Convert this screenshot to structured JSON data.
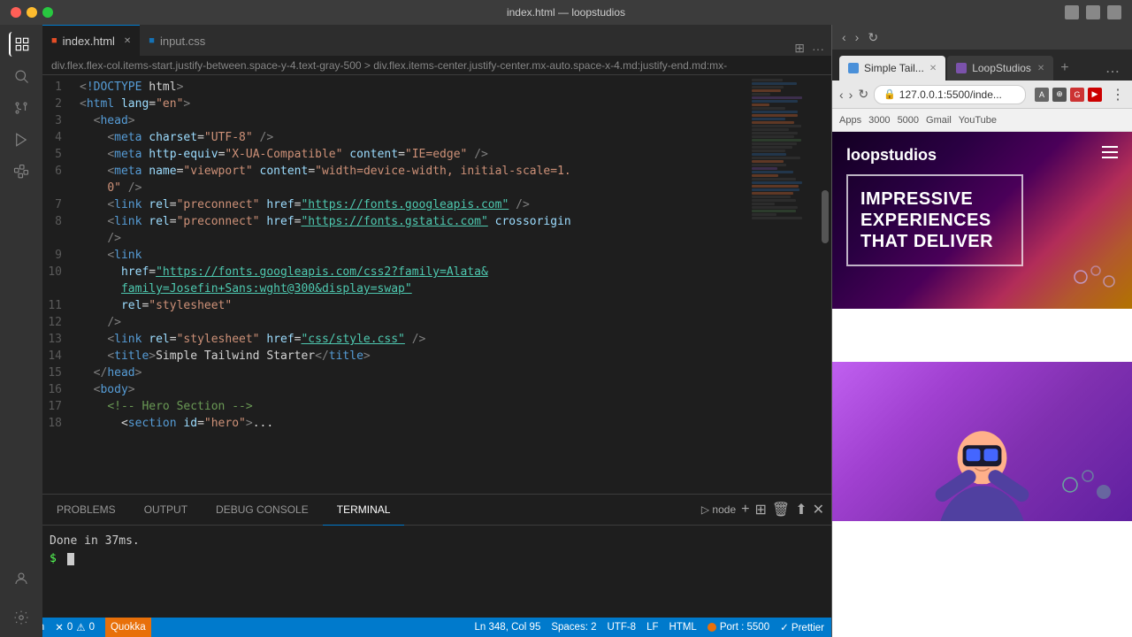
{
  "titlebar": {
    "title": "index.html — loopstudios"
  },
  "tabs": [
    {
      "name": "index.html",
      "type": "html",
      "active": true,
      "modified": false
    },
    {
      "name": "input.css",
      "type": "css",
      "active": false,
      "modified": false
    }
  ],
  "breadcrumb": "div.flex.flex-col.items-start.justify-between.space-y-4.text-gray-500 > div.flex.items-center.justify-center.mx-auto.space-x-4.md:justify-end.md:mx-",
  "code_lines": [
    {
      "num": "1",
      "html": "<span class='t-lt'>&lt;</span><span class='t-keyword'>!DOCTYPE</span><span class='t-plain'> html</span><span class='t-lt'>&gt;</span>"
    },
    {
      "num": "2",
      "html": "<span class='t-lt'>&lt;</span><span class='t-tag'>html</span> <span class='t-attr'>lang</span><span class='t-eq'>=</span><span class='t-val'>\"en\"</span><span class='t-lt'>&gt;</span>"
    },
    {
      "num": "3",
      "html": "  <span class='t-lt'>&lt;</span><span class='t-tag'>head</span><span class='t-lt'>&gt;</span>"
    },
    {
      "num": "4",
      "html": "    <span class='t-lt'>&lt;</span><span class='t-tag'>meta</span> <span class='t-attr'>charset</span><span class='t-eq'>=</span><span class='t-val'>\"UTF-8\"</span> <span class='t-lt'>/&gt;</span>"
    },
    {
      "num": "5",
      "html": "    <span class='t-lt'>&lt;</span><span class='t-tag'>meta</span> <span class='t-attr'>http-equiv</span><span class='t-eq'>=</span><span class='t-val'>\"X-UA-Compatible\"</span> <span class='t-attr'>content</span><span class='t-eq'>=</span><span class='t-val'>\"IE=edge\"</span> <span class='t-lt'>/&gt;</span>"
    },
    {
      "num": "6",
      "html": "    <span class='t-lt'>&lt;</span><span class='t-tag'>meta</span> <span class='t-attr'>name</span><span class='t-eq'>=</span><span class='t-val'>\"viewport\"</span> <span class='t-attr'>content</span><span class='t-eq'>=</span><span class='t-val'>\"width=device-width, initial-scale=1.</span>"
    },
    {
      "num": "",
      "html": "    <span class='t-val'>0\"</span> <span class='t-lt'>/&gt;</span>"
    },
    {
      "num": "7",
      "html": "    <span class='t-lt'>&lt;</span><span class='t-tag'>link</span> <span class='t-attr'>rel</span><span class='t-eq'>=</span><span class='t-val'>\"preconnect\"</span> <span class='t-attr'>href</span><span class='t-eq'>=</span><span class='t-url'>\"https://fonts.googleapis.com\"</span> <span class='t-lt'>/&gt;</span>"
    },
    {
      "num": "8",
      "html": "    <span class='t-lt'>&lt;</span><span class='t-tag'>link</span> <span class='t-attr'>rel</span><span class='t-eq'>=</span><span class='t-val'>\"preconnect\"</span> <span class='t-attr'>href</span><span class='t-eq'>=</span><span class='t-url'>\"https://fonts.gstatic.com\"</span> <span class='t-attr'>crossorigin</span>"
    },
    {
      "num": "",
      "html": "    <span class='t-lt'>/&gt;</span>"
    },
    {
      "num": "9",
      "html": "    <span class='t-lt'>&lt;</span><span class='t-tag'>link</span>"
    },
    {
      "num": "10",
      "html": "      <span class='t-attr'>href</span><span class='t-eq'>=</span><span class='t-url'>\"https://fonts.googleapis.com/css2?family=Alata&amp;</span>"
    },
    {
      "num": "",
      "html": "      <span class='t-url'>family=Josefin+Sans:wght@300&amp;display=swap\"</span>"
    },
    {
      "num": "11",
      "html": "      <span class='t-attr'>rel</span><span class='t-eq'>=</span><span class='t-val'>\"stylesheet\"</span>"
    },
    {
      "num": "12",
      "html": "    <span class='t-lt'>/&gt;</span>"
    },
    {
      "num": "13",
      "html": "    <span class='t-lt'>&lt;</span><span class='t-tag'>link</span> <span class='t-attr'>rel</span><span class='t-eq'>=</span><span class='t-val'>\"stylesheet\"</span> <span class='t-attr'>href</span><span class='t-eq'>=</span><span class='t-url'>\"css/style.css\"</span> <span class='t-lt'>/&gt;</span>"
    },
    {
      "num": "14",
      "html": "    <span class='t-lt'>&lt;</span><span class='t-tag'>title</span><span class='t-lt'>&gt;</span><span class='t-plain'>Simple Tailwind Starter</span><span class='t-lt'>&lt;/</span><span class='t-tag'>title</span><span class='t-lt'>&gt;</span>"
    },
    {
      "num": "15",
      "html": "  <span class='t-lt'>&lt;/</span><span class='t-tag'>head</span><span class='t-lt'>&gt;</span>"
    },
    {
      "num": "16",
      "html": "  <span class='t-lt'>&lt;</span><span class='t-tag'>body</span><span class='t-lt'>&gt;</span>"
    },
    {
      "num": "17",
      "html": "    <span class='t-comment'>&lt;!-- Hero Section --&gt;</span>"
    },
    {
      "num": "18",
      "html": "    <span class='t-plain'>  &lt;</span><span class='t-tag'>section</span> <span class='t-attr'>id</span><span class='t-eq'>=</span><span class='t-val'>\"hero\"</span><span class='t-lt'>&gt;</span>..."
    }
  ],
  "panel_tabs": [
    "PROBLEMS",
    "OUTPUT",
    "DEBUG CONSOLE",
    "TERMINAL"
  ],
  "active_panel_tab": "TERMINAL",
  "terminal_content": "Done in 37ms.",
  "status_bar": {
    "errors": "0",
    "warnings": "0",
    "quokka": "Quokka",
    "line": "Ln 348, Col 95",
    "spaces": "Spaces: 2",
    "encoding": "UTF-8",
    "eol": "LF",
    "language": "HTML",
    "port": "Port : 5500",
    "prettier": "✓ Prettier"
  },
  "browser": {
    "tabs": [
      {
        "name": "Simple Tail...",
        "active": true
      },
      {
        "name": "LoopStudios",
        "active": false
      }
    ],
    "address": "127.0.0.1:5500/inde...",
    "bookmarks": [
      "Apps",
      "3000",
      "5000",
      "Gmail",
      "YouTube"
    ]
  },
  "preview": {
    "logo": "loopstudios",
    "headline": "IMPRESSIVE EXPERIENCES THAT DELIVER"
  }
}
